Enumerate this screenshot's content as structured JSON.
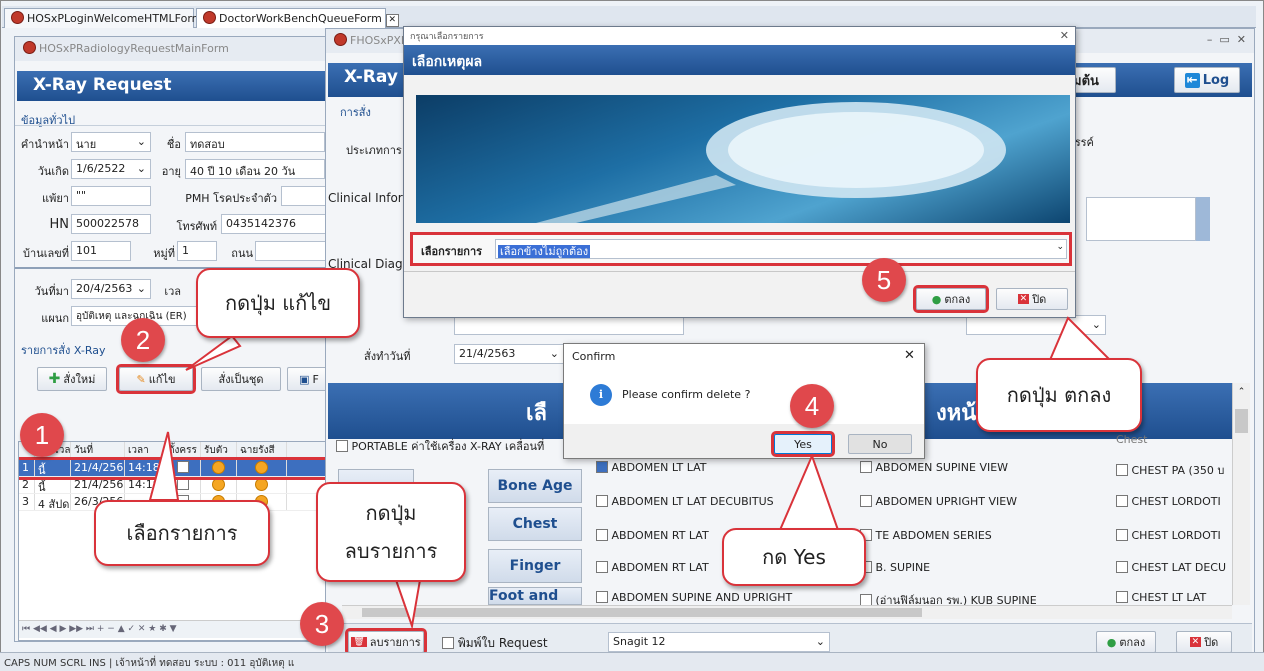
{
  "tabs": [
    "HOSxPLoginWelcomeHTMLForm",
    "DoctorWorkBenchQueueForm"
  ],
  "left_form": {
    "title": "HOSxPRadiologyRequestMainForm",
    "header": "X-Ray Request",
    "section_general": "ข้อมูลทั่วไป",
    "prefix_label": "คำนำหน้า",
    "prefix_value": "นาย",
    "name_label": "ชื่อ",
    "name_value": "ทดสอบ",
    "dob_label": "วันเกิด",
    "dob_value": "1/6/2522",
    "age_label": "อายุ",
    "age_value": "40 ปี 10 เดือน 20 วัน",
    "allergy_label": "แพ้ยา",
    "allergy_value": "\"\"",
    "pmh_label": "PMH โรคประจำตัว",
    "hn_label": "HN",
    "hn_value": "500022578",
    "phone_label": "โทรศัพท์",
    "phone_value": "0435142376",
    "house_label": "บ้านเลขที่",
    "house_value": "101",
    "moo_label": "หมู่ที่",
    "moo_value": "1",
    "road_label": "ถนน",
    "visit_label": "วันที่มา",
    "visit_value": "20/4/2563",
    "time_label": "เวล",
    "dept_label": "แผนก",
    "dept_value": "อุบัติเหตุ และฉุกเฉิน (ER)",
    "section_orders": "รายการสั่ง X-Ray",
    "btn_new": "สั่งใหม่",
    "btn_edit": "แก้ไข",
    "btn_set": "สั่งเป็นชุด",
    "btn_f": "F"
  },
  "grid": {
    "headers": [
      "",
      "ช่วงเวล",
      "วันที่",
      "เวลา",
      "ตั้งครร",
      "รับตัว",
      "ฉายรังสี"
    ],
    "rows": [
      {
        "no": "1",
        "period": "นี้",
        "date": "21/4/2563",
        "time": "14:18",
        "selected": true
      },
      {
        "no": "2",
        "period": "นี้",
        "date": "21/4/2563",
        "time": "14:19",
        "selected": false
      },
      {
        "no": "3",
        "period": "4 สัปดาห์",
        "date": "26/3/2563",
        "time": "",
        "selected": false
      }
    ]
  },
  "main_form": {
    "title": "FHOSxPXR",
    "header": "X-Ray R",
    "order_tab": "การสั่ง",
    "type_label": "ประเภทการ",
    "clinical_info": "Clinical Infor",
    "clinical_diag": "Clinical Diag",
    "order_date_label": "สั่งทำวันที่",
    "order_date_value": "21/4/2563",
    "right_button_partial": "มต้น",
    "log_button": "Log",
    "right_label_partial": "ธรรค์",
    "band_left": "เลื",
    "band_right": "งหน้า",
    "portable_label": "PORTABLE ค่าใช้เครื่อง X-RAY เคลื่อนที่",
    "side_buttons": [
      "Bone Age",
      "Chest",
      "Finger",
      "Foot and toe"
    ],
    "col1": [
      "ABDOMEN LT LAT",
      "ABDOMEN LT LAT DECUBITUS",
      "ABDOMEN RT LAT",
      "ABDOMEN RT LAT",
      "ABDOMEN SUPINE AND UPRIGHT"
    ],
    "col2": [
      "ABDOMEN SUPINE VIEW",
      "ABDOMEN UPRIGHT VIEW",
      "TE ABDOMEN SERIES",
      "B. SUPINE",
      "(อ่านฟิล์มนอก รพ.) KUB SUPINE"
    ],
    "col3_header": "Chest",
    "col3": [
      "CHEST PA (350 บ",
      "CHEST LORDOTI",
      "CHEST LORDOTI",
      "CHEST LAT DECU",
      "CHEST LT LAT"
    ],
    "delete_button": "ลบรายการ",
    "print_label": "พิมพ์ใบ Request",
    "printer_value": "Snagit 12",
    "ok_button": "ตกลง",
    "close_button": "ปิด"
  },
  "reason_dialog": {
    "window_title": "กรุณาเลือกรายการ",
    "header": "เลือกเหตุผล",
    "select_label": "เลือกรายการ",
    "select_value": "เลือกข้างไม่ถูกต้อง",
    "ok_button": "ตกลง",
    "close_button": "ปิด"
  },
  "confirm": {
    "title": "Confirm",
    "message": "Please confirm delete ?",
    "yes": "Yes",
    "no": "No"
  },
  "callouts": {
    "c1": "เลือกรายการ",
    "c2": "กดปุ่ม แก้ไข",
    "c3a": "กดปุ่ม",
    "c3b": "ลบรายการ",
    "c4": "กด Yes",
    "c5": "กดปุ่ม ตกลง"
  },
  "step_numbers": [
    "1",
    "2",
    "3",
    "4",
    "5"
  ],
  "status_bar": "CAPS  NUM  SCRL  INS  |  เจ้าหน้าที่ ทดสอบ ระบบ : 011 อุบัติเหตุ แ",
  "colors": {
    "accent": "#1f4f8f",
    "highlight": "#d9333a",
    "selection": "#3d6fbf"
  }
}
